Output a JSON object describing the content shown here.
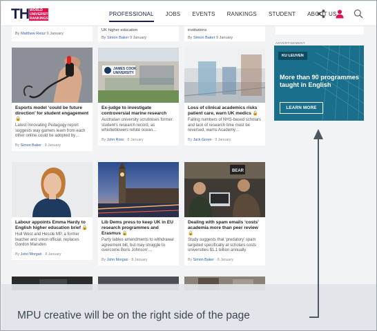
{
  "logo": {
    "text": "THE",
    "sub": "WORLD UNIVERSITY RANKINGS"
  },
  "nav": [
    "PROFESSIONAL",
    "JOBS",
    "EVENTS",
    "RANKINGS",
    "STUDENT",
    "ABOUT US"
  ],
  "header_icons": [
    "share-icon",
    "user-icon",
    "search-icon"
  ],
  "top_strips": [
    {
      "pre": "",
      "meta_by": "By",
      "author": "Matthew Reisz",
      "date": "9 January"
    },
    {
      "pre": "UK higher education",
      "meta_by": "By",
      "author": "Simon Baker",
      "date": "9 January"
    },
    {
      "pre": "institutions",
      "meta_by": "By",
      "author": "Simon Baker",
      "date": "9 January"
    }
  ],
  "cards": [
    {
      "title": "Esports model ‘could be future direction’ for student engagement",
      "desc": "Latest Innovating Pedagogy report suggests way gamers learn from each other online could be adopted by…",
      "author": "Simon Baker",
      "date": "9 January"
    },
    {
      "title": "Ex-judge to investigate controversial marine research",
      "desc": "Australian university scrutinises former student’s research record, as whistleblowers refute ocean…",
      "author": "John Ross",
      "date": "8 January"
    },
    {
      "title": "Loss of clinical academics risks patient care, warn UK medics",
      "desc": "Falling numbers of NHS-based scholars and lack of research time must be reversed, warns Academy…",
      "author": "Jack Grove",
      "date": "9 January"
    },
    {
      "title": "Labour appoints Emma Hardy to English higher education brief",
      "desc": "Hull West and Hessle MP, a former teacher and union official, replaces Gordon Marsden",
      "author": "John Morgan",
      "date": "8 January"
    },
    {
      "title": "Lib Dems press to keep UK in EU research programmes and Erasmus",
      "desc": "Party tables amendments to withdrawal agreement bill, but may struggle to overcome Boris Johnson’…",
      "author": "John Morgan",
      "date": "8 January"
    },
    {
      "title": "Dealing with spam emails ‘costs’ academia more than peer review",
      "desc": "Study suggests that ‘predatory’ spam targeted specifically at scholars costs universities $1.1 billion annually",
      "author": "Simon Baker",
      "date": "8 January"
    }
  ],
  "by_label": "By",
  "ad": {
    "label": "ADVERTISEMENT",
    "badge": "KU LEUVEN",
    "headline": "More than 90 programmes taught in English",
    "cta": "LEARN MORE"
  },
  "caption": "MPU creative will be on the right side of the page",
  "colors": {
    "brand_navy": "#1c1f4a",
    "brand_pink": "#e0114f",
    "ad_teal": "#1a6f8c",
    "link_blue": "#2a5ca8"
  }
}
